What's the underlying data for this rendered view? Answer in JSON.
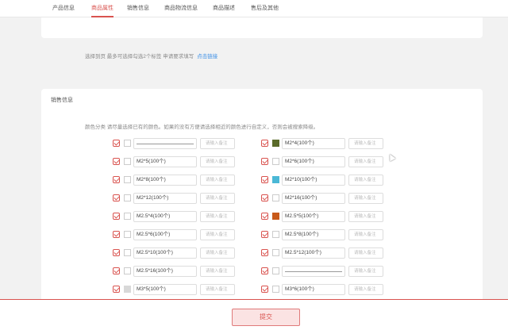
{
  "tabs": [
    {
      "label": "产品信息",
      "active": false
    },
    {
      "label": "商品属性",
      "active": true
    },
    {
      "label": "销售信息",
      "active": false
    },
    {
      "label": "商品物流信息",
      "active": false
    },
    {
      "label": "商品描述",
      "active": false
    },
    {
      "label": "售后及其他",
      "active": false
    }
  ],
  "notice": {
    "text": "选择到页  最多可选择勾选2个标签    申请要求填写",
    "link": "点击链接"
  },
  "sales": {
    "title": "销售信息",
    "hint": "颜色分类  请尽量选择已有的颜色。如果的没有方便请选择相近的颜色进行自定义，否则会被搜索降级。",
    "remark_placeholder": "请输入备注"
  },
  "colors": {
    "accent": "#d9534f",
    "olive": "#5a6b2a",
    "cyan": "#4bb8d6",
    "orange": "#c85a1a",
    "lightgray": "#d8d8d8"
  },
  "left_items": [
    {
      "text": "",
      "swatch": "none",
      "is_line": true
    },
    {
      "text": "M2*5(100个)",
      "swatch": "none",
      "is_line": false
    },
    {
      "text": "M2*8(100个)",
      "swatch": "none",
      "is_line": false
    },
    {
      "text": "M2*12(100个)",
      "swatch": "none",
      "is_line": false
    },
    {
      "text": "M2.5*4(100个)",
      "swatch": "none",
      "is_line": false
    },
    {
      "text": "M2.5*6(100个)",
      "swatch": "none",
      "is_line": false
    },
    {
      "text": "M2.5*10(100个)",
      "swatch": "none",
      "is_line": false
    },
    {
      "text": "M2.5*16(100个)",
      "swatch": "none",
      "is_line": false
    },
    {
      "text": "M3*5(100个)",
      "swatch": "lightgray",
      "is_line": false
    }
  ],
  "right_items": [
    {
      "text": "M2*4(100个)",
      "swatch": "olive",
      "is_line": false
    },
    {
      "text": "M2*6(100个)",
      "swatch": "none",
      "is_line": false
    },
    {
      "text": "M2*10(100个)",
      "swatch": "cyan",
      "is_line": false
    },
    {
      "text": "M2*16(100个)",
      "swatch": "none",
      "is_line": false
    },
    {
      "text": "M2.5*5(100个)",
      "swatch": "orange",
      "is_line": false
    },
    {
      "text": "M2.5*8(100个)",
      "swatch": "none",
      "is_line": false
    },
    {
      "text": "M2.5*12(100个)",
      "swatch": "none",
      "is_line": false
    },
    {
      "text": "",
      "swatch": "none",
      "is_line": true
    },
    {
      "text": "M3*6(100个)",
      "swatch": "none",
      "is_line": false
    }
  ],
  "submit_label": "提交"
}
